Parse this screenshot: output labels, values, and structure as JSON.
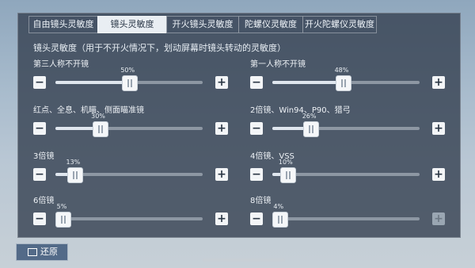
{
  "tabs": [
    {
      "label": "自由镜头灵敏度",
      "active": false
    },
    {
      "label": "镜头灵敏度",
      "active": true
    },
    {
      "label": "开火镜头灵敏度",
      "active": false
    },
    {
      "label": "陀螺仪灵敏度",
      "active": false
    },
    {
      "label": "开火陀螺仪灵敏度",
      "active": false
    }
  ],
  "subtitle": "镜头灵敏度（用于不开火情况下，划动屏幕时镜头转动的灵敏度）",
  "settings": [
    {
      "label": "第三人称不开镜",
      "percent": "50%",
      "value": 50
    },
    {
      "label": "第一人称不开镜",
      "percent": "48%",
      "value": 48
    },
    {
      "label": "红点、全息、机瞄、侧面瞄准镜",
      "percent": "30%",
      "value": 30
    },
    {
      "label": "2倍镜、Win94、P90、猎弓",
      "percent": "26%",
      "value": 26
    },
    {
      "label": "3倍镜",
      "percent": "13%",
      "value": 13
    },
    {
      "label": "4倍镜、VSS",
      "percent": "10%",
      "value": 10
    },
    {
      "label": "6倍镜",
      "percent": "5%",
      "value": 5
    },
    {
      "label": "8倍镜",
      "percent": "4%",
      "value": 4
    }
  ],
  "buttons": {
    "minus": "−",
    "plus": "+"
  },
  "reset": {
    "label": "还原",
    "icon": "screen-icon"
  }
}
